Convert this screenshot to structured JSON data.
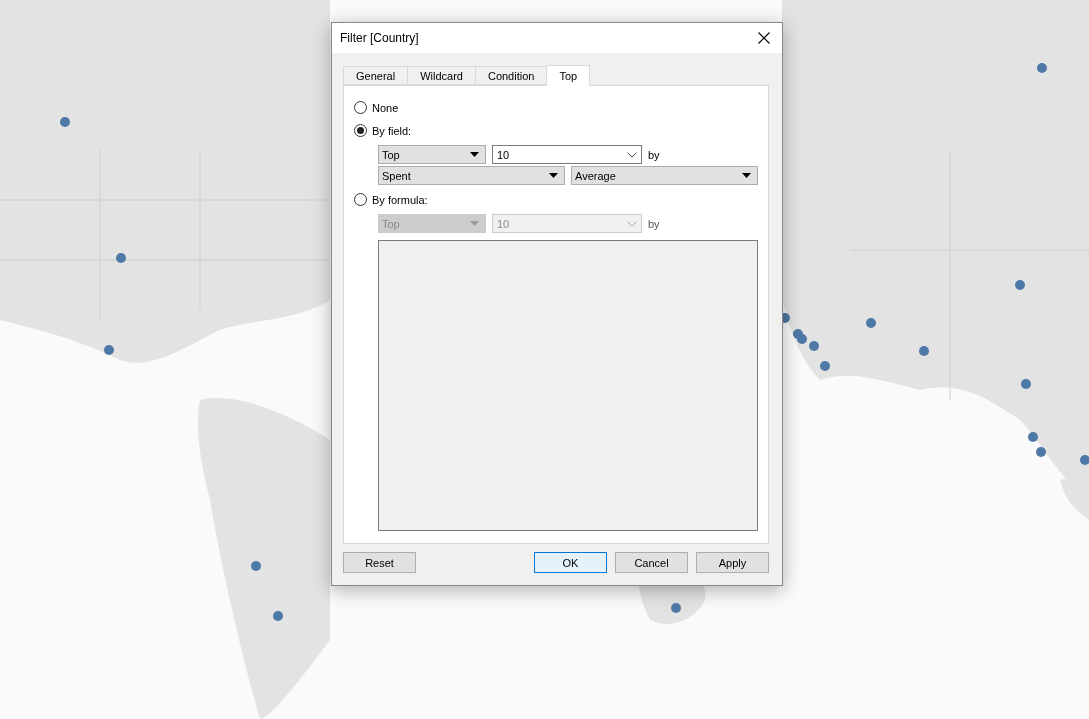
{
  "dialog": {
    "title": "Filter [Country]",
    "tabs": [
      {
        "label": "General",
        "selected": false
      },
      {
        "label": "Wildcard",
        "selected": false
      },
      {
        "label": "Condition",
        "selected": false
      },
      {
        "label": "Top",
        "selected": true
      }
    ],
    "none_option": {
      "label": "None",
      "selected": false
    },
    "by_field": {
      "label": "By field:",
      "selected": true,
      "disabled": false,
      "mode": "Top",
      "count": "10",
      "by_label": "by",
      "field": "Spent",
      "aggregation": "Average"
    },
    "by_formula": {
      "label": "By formula:",
      "selected": false,
      "disabled": true,
      "mode": "Top",
      "count": "10",
      "by_label": "by"
    },
    "buttons": [
      {
        "label": "Reset",
        "default": false
      },
      {
        "label": "OK",
        "default": true
      },
      {
        "label": "Cancel",
        "default": false
      },
      {
        "label": "Apply",
        "default": false
      }
    ]
  }
}
